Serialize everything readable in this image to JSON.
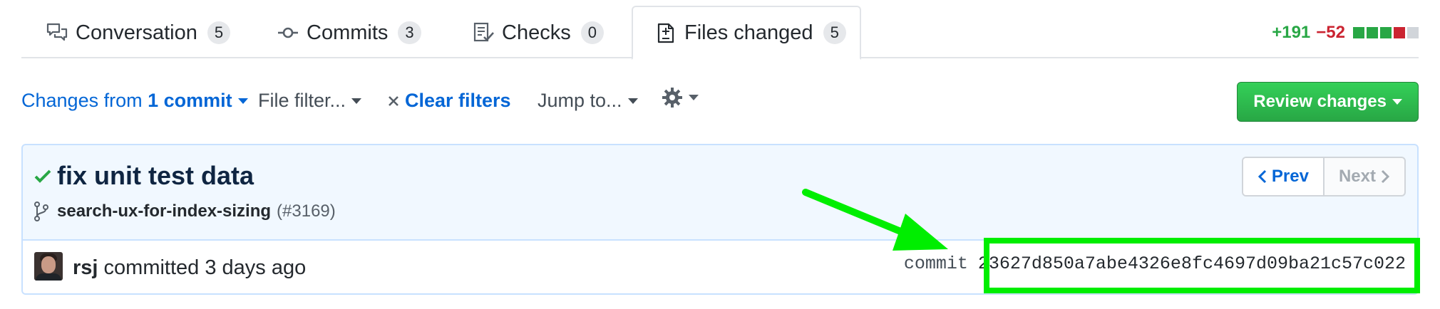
{
  "tabs": [
    {
      "label": "Conversation",
      "count": "5",
      "icon": "comment-discussion-icon"
    },
    {
      "label": "Commits",
      "count": "3",
      "icon": "git-commit-icon"
    },
    {
      "label": "Checks",
      "count": "0",
      "icon": "checklist-icon"
    },
    {
      "label": "Files changed",
      "count": "5",
      "icon": "file-diff-icon",
      "selected": true
    }
  ],
  "diffstat": {
    "additions": "+191",
    "deletions": "−52",
    "blocks": [
      "#28a745",
      "#28a745",
      "#28a745",
      "#cb2431",
      "#d1d5da"
    ]
  },
  "toolbar": {
    "changes_prefix": "Changes from",
    "changes_commit": "1 commit",
    "file_filter": "File filter...",
    "clear_filters": "Clear filters",
    "jump_to": "Jump to...",
    "settings_icon": "gear-icon",
    "review_button": "Review changes"
  },
  "commit": {
    "status_icon": "check-icon",
    "title": "fix unit test data",
    "branch_icon": "git-branch-icon",
    "branch": "search-ux-for-index-sizing",
    "pr_ref": "(#3169)",
    "prev": "Prev",
    "next": "Next",
    "author": "rsj",
    "action": "committed 3 days ago",
    "sha_label": "commit",
    "sha": "23627d850a7abe4326e8fc4697d09ba21c57c022"
  },
  "colors": {
    "link": "#0366d6",
    "primary_button": "#2ea44f",
    "commit_box_bg": "#f1f8ff",
    "annotation": "#00ee00"
  }
}
